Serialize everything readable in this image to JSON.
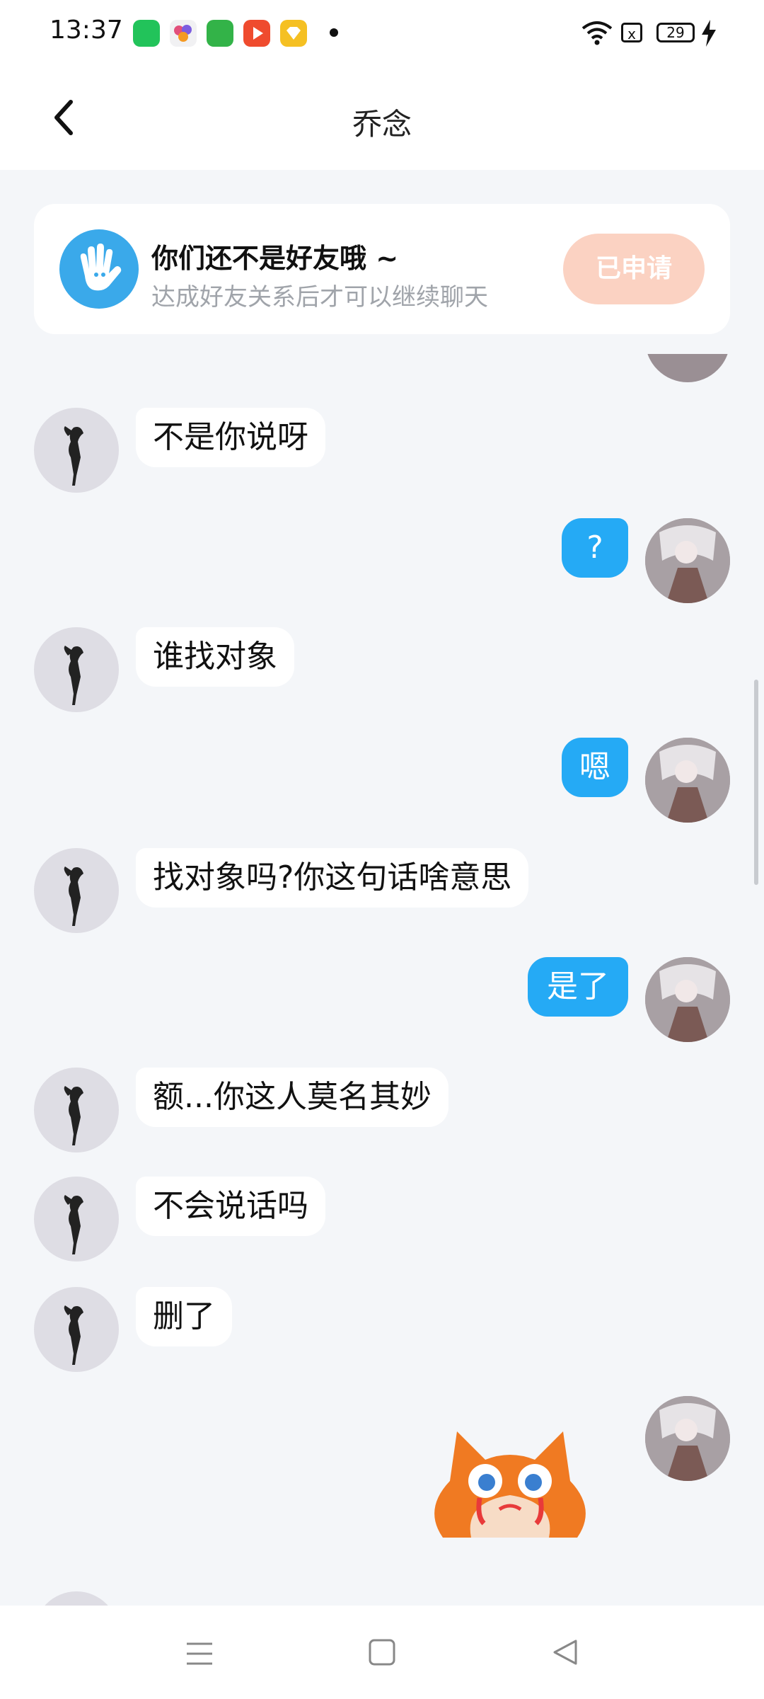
{
  "status_bar": {
    "time": "13:37",
    "apps": [
      {
        "icon": "iqiyi-icon",
        "color": "#22c35a"
      },
      {
        "icon": "flower-app-icon",
        "color": "#e24f7b"
      },
      {
        "icon": "shopping-bag-icon",
        "color": "#33b348"
      },
      {
        "icon": "video-play-icon",
        "color": "#ef4b2e"
      },
      {
        "icon": "coupon-icon",
        "color": "#f5c023"
      }
    ],
    "sim_label": "x",
    "battery": "29"
  },
  "header": {
    "title": "乔念",
    "back_icon": "chevron-left-icon"
  },
  "friend_banner": {
    "title": "你们还不是好友哦 ~",
    "subtitle": "达成好友关系后才可以继续聊天",
    "button": "已申请",
    "icon": "hand-wave-icon"
  },
  "messages": [
    {
      "from": "other",
      "text": "不是你说呀"
    },
    {
      "from": "me",
      "text": "?"
    },
    {
      "from": "other",
      "text": "谁找对象"
    },
    {
      "from": "me",
      "text": "嗯"
    },
    {
      "from": "other",
      "text": "找对象吗?你这句话啥意思"
    },
    {
      "from": "me",
      "text": "是了"
    },
    {
      "from": "other",
      "text": "额...你这人莫名其妙"
    },
    {
      "from": "other",
      "text": "不会说话吗"
    },
    {
      "from": "other",
      "text": "删了"
    },
    {
      "from": "me",
      "sticker": "crying-fox-sticker"
    }
  ],
  "nav_bar": {
    "menu_icon": "menu-icon",
    "home_icon": "square-home-icon",
    "back_icon": "triangle-back-icon"
  },
  "colors": {
    "my_bubble": "#25aaf5",
    "banner_button": "#fbd2c2",
    "background": "#f4f6f9"
  }
}
